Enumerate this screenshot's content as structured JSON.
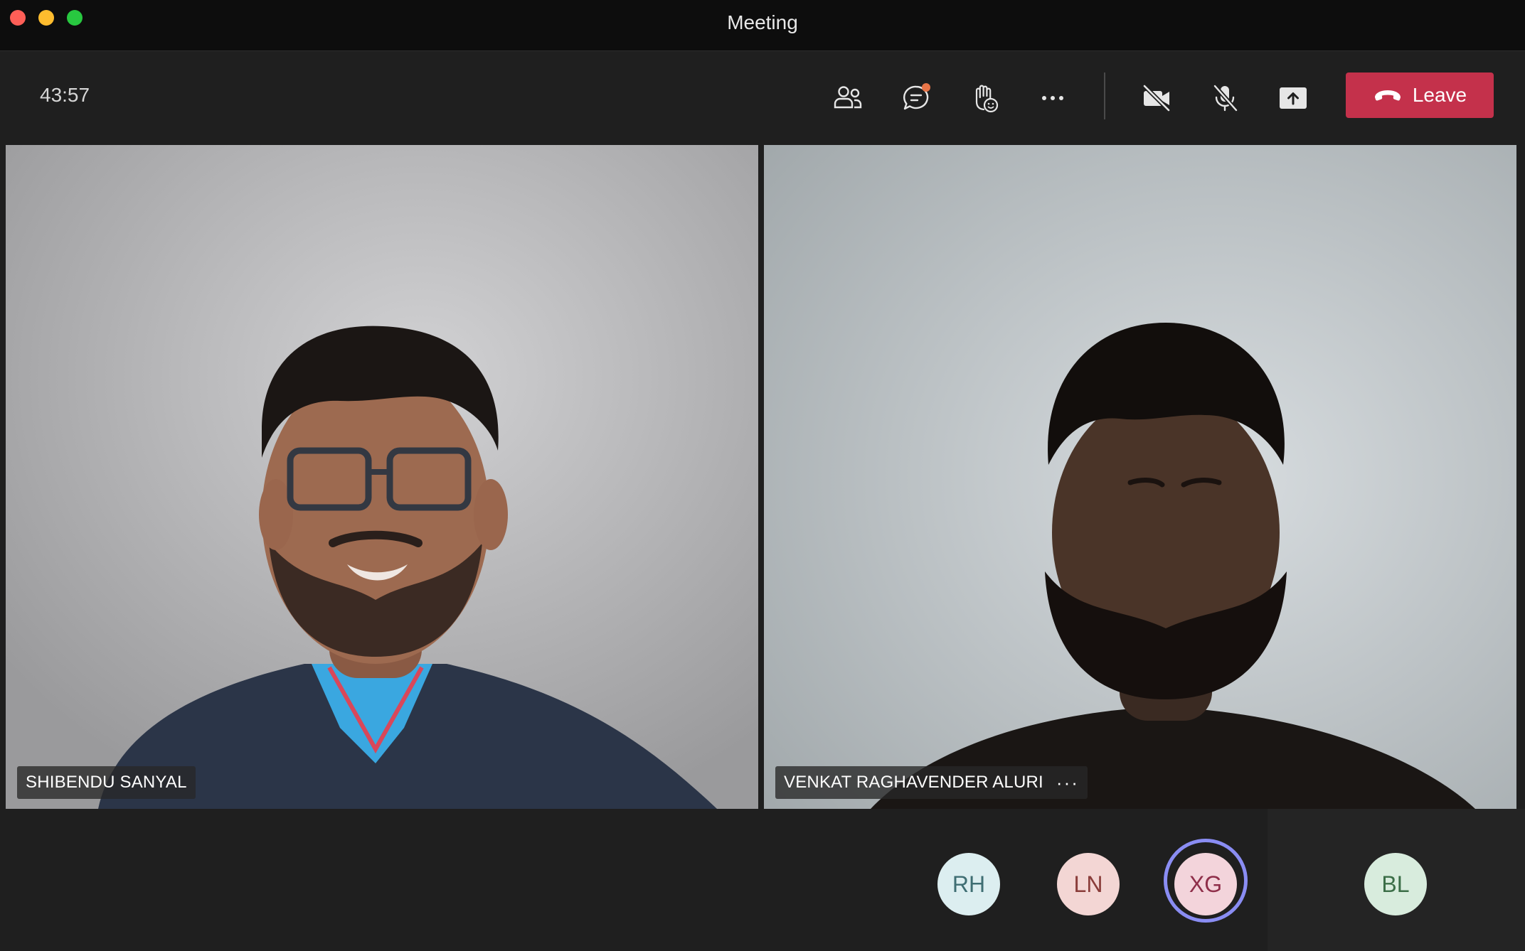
{
  "window": {
    "title": "Meeting"
  },
  "toolbar": {
    "timer": "43:57",
    "buttons": [
      {
        "name": "participants",
        "icon": "people-icon"
      },
      {
        "name": "chat",
        "icon": "chat-icon"
      },
      {
        "name": "reactions",
        "icon": "raise-hand-icon"
      },
      {
        "name": "more",
        "icon": "more-icon"
      },
      {
        "name": "camera",
        "icon": "camera-off-icon"
      },
      {
        "name": "mic",
        "icon": "mic-off-icon"
      },
      {
        "name": "share",
        "icon": "share-icon"
      }
    ],
    "leave_label": "Leave",
    "colors": {
      "leave": "#c4314b",
      "chat_badge": "#e97548"
    }
  },
  "participants": [
    {
      "name": "SHIBENDU SANYAL"
    },
    {
      "name": "VENKAT RAGHAVENDER ALURI",
      "more": "···"
    }
  ],
  "roster": [
    {
      "initials": "RH",
      "bg": "#dceef0",
      "fg": "#3f6e73"
    },
    {
      "initials": "LN",
      "bg": "#f3d6d4",
      "fg": "#8a3d3a"
    },
    {
      "initials": "XG",
      "bg": "#f3d4db",
      "fg": "#8f2f4a",
      "speaking": true
    },
    {
      "initials": "BL",
      "bg": "#d8ecdd",
      "fg": "#3b6e47"
    }
  ]
}
